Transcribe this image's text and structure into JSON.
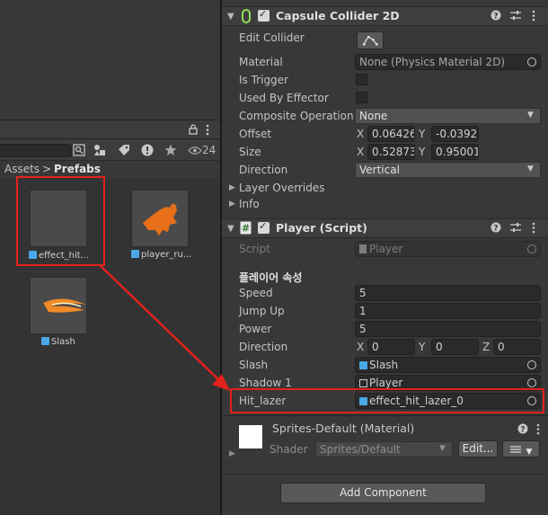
{
  "project": {
    "lock_icon": "lock-icon",
    "menu_icon": "kebab-menu-icon",
    "hidden_count": "24",
    "breadcrumb": {
      "root": "Assets",
      "sep": ">",
      "current": "Prefabs"
    },
    "assets": [
      {
        "label": "effect_hit...",
        "kind": "prefab"
      },
      {
        "label": "player_ru...",
        "kind": "prefab"
      },
      {
        "label": "Slash",
        "kind": "prefab"
      }
    ]
  },
  "capsule": {
    "title": "Capsule Collider 2D",
    "edit_collider_label": "Edit Collider",
    "material_label": "Material",
    "material_value": "None (Physics Material 2D)",
    "is_trigger_label": "Is Trigger",
    "used_by_effector_label": "Used By Effector",
    "composite_label": "Composite Operation",
    "composite_value": "None",
    "offset_label": "Offset",
    "offset_x": "0.06426",
    "offset_y": "-0.0392",
    "size_label": "Size",
    "size_x": "0.52873",
    "size_y": "0.95001",
    "direction_label": "Direction",
    "direction_value": "Vertical",
    "layer_overrides_label": "Layer Overrides",
    "info_label": "Info",
    "x": "X",
    "y": "Y"
  },
  "player": {
    "title": "Player (Script)",
    "script_label": "Script",
    "script_value": "Player",
    "section_header": "플레이어 속성",
    "speed_label": "Speed",
    "speed_value": "5",
    "jump_label": "Jump Up",
    "jump_value": "1",
    "power_label": "Power",
    "power_value": "5",
    "direction_label": "Direction",
    "dir_x_label": "X",
    "dir_x": "0",
    "dir_y_label": "Y",
    "dir_y": "0",
    "dir_z_label": "Z",
    "dir_z": "0",
    "slash_label": "Slash",
    "slash_value": "Slash",
    "shadow_label": "Shadow 1",
    "shadow_value": "Player",
    "hit_label": "Hit_lazer",
    "hit_value": "effect_hit_lazer_0"
  },
  "material": {
    "title": "Sprites-Default (Material)",
    "shader_label": "Shader",
    "shader_value": "Sprites/Default",
    "edit_button": "Edit..."
  },
  "add_component": "Add Component",
  "colors": {
    "highlight": "#e3221c",
    "prefab_blue": "#4aa8e8",
    "sprite_orange": "#e8701a"
  }
}
